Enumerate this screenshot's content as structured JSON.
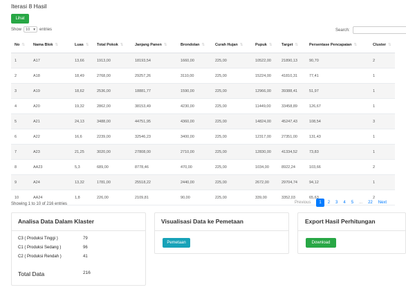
{
  "page": {
    "title": "Iterasi 8 Hasil",
    "lihat_button": "Lihat",
    "show_label": "Show",
    "show_value": "10",
    "entries_label": "entries",
    "search_label": "Search:"
  },
  "table": {
    "columns": [
      "No",
      "Nama Blok",
      "Luas",
      "Total Pokok",
      "Janjang Panen",
      "Brondolan",
      "Curah Hujan",
      "Pupuk",
      "Target",
      "Persentase Pencapaian",
      "Cluster"
    ],
    "rows": [
      [
        "1",
        "A17",
        "13,66",
        "1913,00",
        "18193,54",
        "1660,00",
        "225,00",
        "10522,00",
        "21890,13",
        "90,70",
        "2"
      ],
      [
        "2",
        "A18",
        "18,49",
        "2768,00",
        "29257,26",
        "3110,00",
        "225,00",
        "15224,00",
        "41810,31",
        "77,41",
        "1"
      ],
      [
        "3",
        "A19",
        "18,62",
        "2536,00",
        "18881,77",
        "1590,00",
        "225,00",
        "12966,00",
        "39388,41",
        "51,97",
        "1"
      ],
      [
        "4",
        "A20",
        "19,32",
        "2862,00",
        "38153,49",
        "4230,00",
        "225,00",
        "11449,00",
        "33458,89",
        "126,67",
        "1"
      ],
      [
        "5",
        "A21",
        "24,13",
        "3488,00",
        "44751,95",
        "4360,00",
        "225,00",
        "14824,00",
        "45247,43",
        "108,54",
        "3"
      ],
      [
        "6",
        "A22",
        "16,6",
        "2239,00",
        "32546,23",
        "3400,00",
        "225,00",
        "12317,00",
        "27351,00",
        "131,43",
        "1"
      ],
      [
        "7",
        "A23",
        "21,25",
        "3020,00",
        "27808,00",
        "2710,00",
        "225,00",
        "12830,00",
        "41334,52",
        "73,83",
        "1"
      ],
      [
        "8",
        "AA23",
        "5,3",
        "689,00",
        "8778,46",
        "470,00",
        "225,00",
        "1034,00",
        "8922,24",
        "103,66",
        "2"
      ],
      [
        "9",
        "A24",
        "13,32",
        "1781,00",
        "25518,22",
        "2440,00",
        "225,00",
        "2672,00",
        "29704,74",
        "94,12",
        "1"
      ],
      [
        "10",
        "AA24",
        "1,8",
        "226,00",
        "2109,81",
        "90,00",
        "225,00",
        "339,00",
        "3352,03",
        "65,63",
        "2"
      ]
    ]
  },
  "pagination": {
    "info": "Showing 1 to 10 of 216 entries",
    "previous": "Previous",
    "pages": [
      "1",
      "2",
      "3",
      "4",
      "5"
    ],
    "ellipsis": "...",
    "last": "22",
    "next": "Next"
  },
  "analisa": {
    "title": "Analisa Data Dalam Klaster",
    "items": [
      {
        "label": "C3 ( Produksi Tinggi )",
        "value": "79"
      },
      {
        "label": "C1 ( Produksi Sedang )",
        "value": "96"
      },
      {
        "label": "C2 ( Produksi Rendah )",
        "value": "41"
      }
    ],
    "total_label": "Total Data",
    "total_value": "216"
  },
  "visualisasi": {
    "title": "Visualisasi Data ke Pemetaan",
    "button": "Pemetaan"
  },
  "export": {
    "title": "Export Hasil Perhitungan",
    "button": "Download"
  }
}
